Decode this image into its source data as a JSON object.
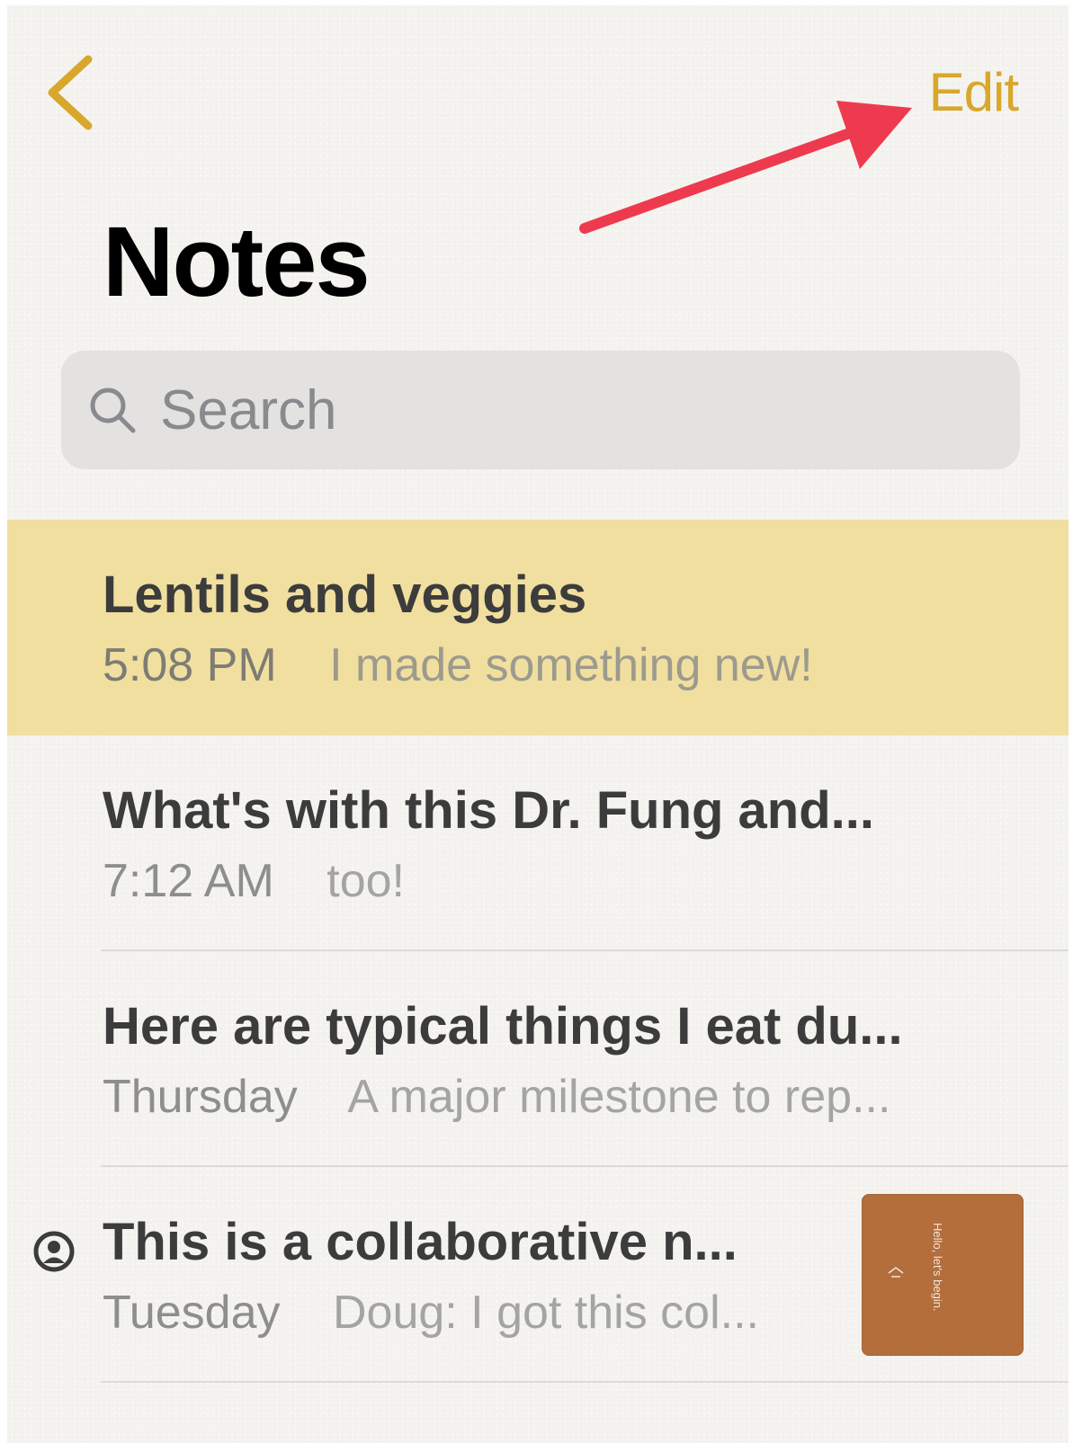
{
  "nav": {
    "back_icon": "chevron-left-icon",
    "edit_label": "Edit"
  },
  "header": {
    "title": "Notes"
  },
  "search": {
    "icon": "search-icon",
    "placeholder": "Search"
  },
  "notes": [
    {
      "title": "Lentils and veggies",
      "date": "5:08 PM",
      "preview": "I made something new!",
      "selected": true
    },
    {
      "title": "What's with this Dr. Fung and...",
      "date": "7:12 AM",
      "preview": "too!",
      "selected": false
    },
    {
      "title": "Here are typical things I eat du...",
      "date": "Thursday",
      "preview": "A major milestone to rep...",
      "selected": false
    },
    {
      "title": "This is a collaborative n...",
      "date": "Tuesday",
      "preview": "Doug: I got this col...",
      "selected": false,
      "shared_icon": "person-circle-icon",
      "thumbnail": {
        "text": "Hello, let's begin.",
        "color": "#b36e3c"
      }
    }
  ],
  "colors": {
    "accent": "#d8a72c",
    "selected_row": "#f1df9f",
    "annotation_arrow": "#ee3a4f"
  }
}
